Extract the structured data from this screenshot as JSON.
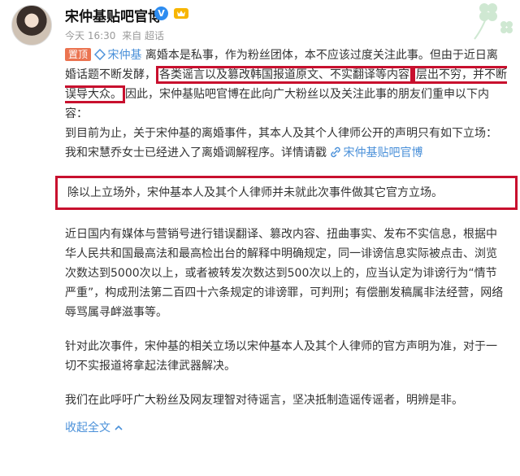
{
  "author": {
    "name": "宋仲基贴吧官博",
    "verified_badge": "V",
    "time": "今天 16:30",
    "source": "来自 超话"
  },
  "post": {
    "pinned_label": "置顶",
    "topic_link": "宋仲基",
    "p1_a": "离婚本是私事，作为粉丝团体，本不应该过度关注此事。但由于近日离婚话题不断发酵，",
    "p1_hl1": "各类谣言以及篡改韩国报道原文、不实翻译等内容",
    "p1_hl2": "层出不穷，并不断误导大众。",
    "p1_b": "因此，宋仲基贴吧官博在此向广大粉丝以及关注此事的朋友们重申以下内容：",
    "p2": "到目前为止，关于宋仲基的离婚事件，其本人及其个人律师公开的声明只有如下立场：",
    "p3_text": "我和宋慧乔女士已经进入了离婚调解程序。详情请戳",
    "p3_link": "宋仲基贴吧官博",
    "p4": "除以上立场外，宋仲基本人及其个人律师并未就此次事件做其它官方立场。",
    "p5": "近日国内有媒体与营销号进行错误翻译、篡改内容、扭曲事实、发布不实信息，根据中华人民共和国最高法和最高检出台的解释中明确规定，同一诽谤信息实际被点击、浏览次数达到5000次以上，或者被转发次数达到500次以上的，应当认定为诽谤行为“情节严重”，构成刑法第二百四十六条规定的诽谤罪，可判刑；有偿删发稿属非法经营，网络辱骂属寻衅滋事等。",
    "p6": "针对此次事件，宋仲基的相关立场以宋仲基本人及其个人律师的官方声明为准，对于一切不实报道将拿起法律武器解决。",
    "p7": "我们在此呼吁广大粉丝及网友理智对待谣言，坚决抵制造谣传谣者，明辨是非。",
    "collapse_label": "收起全文"
  },
  "colors": {
    "highlight_border": "#c8102e",
    "link_orange": "#eb7350",
    "link_blue": "#4a90d9"
  }
}
